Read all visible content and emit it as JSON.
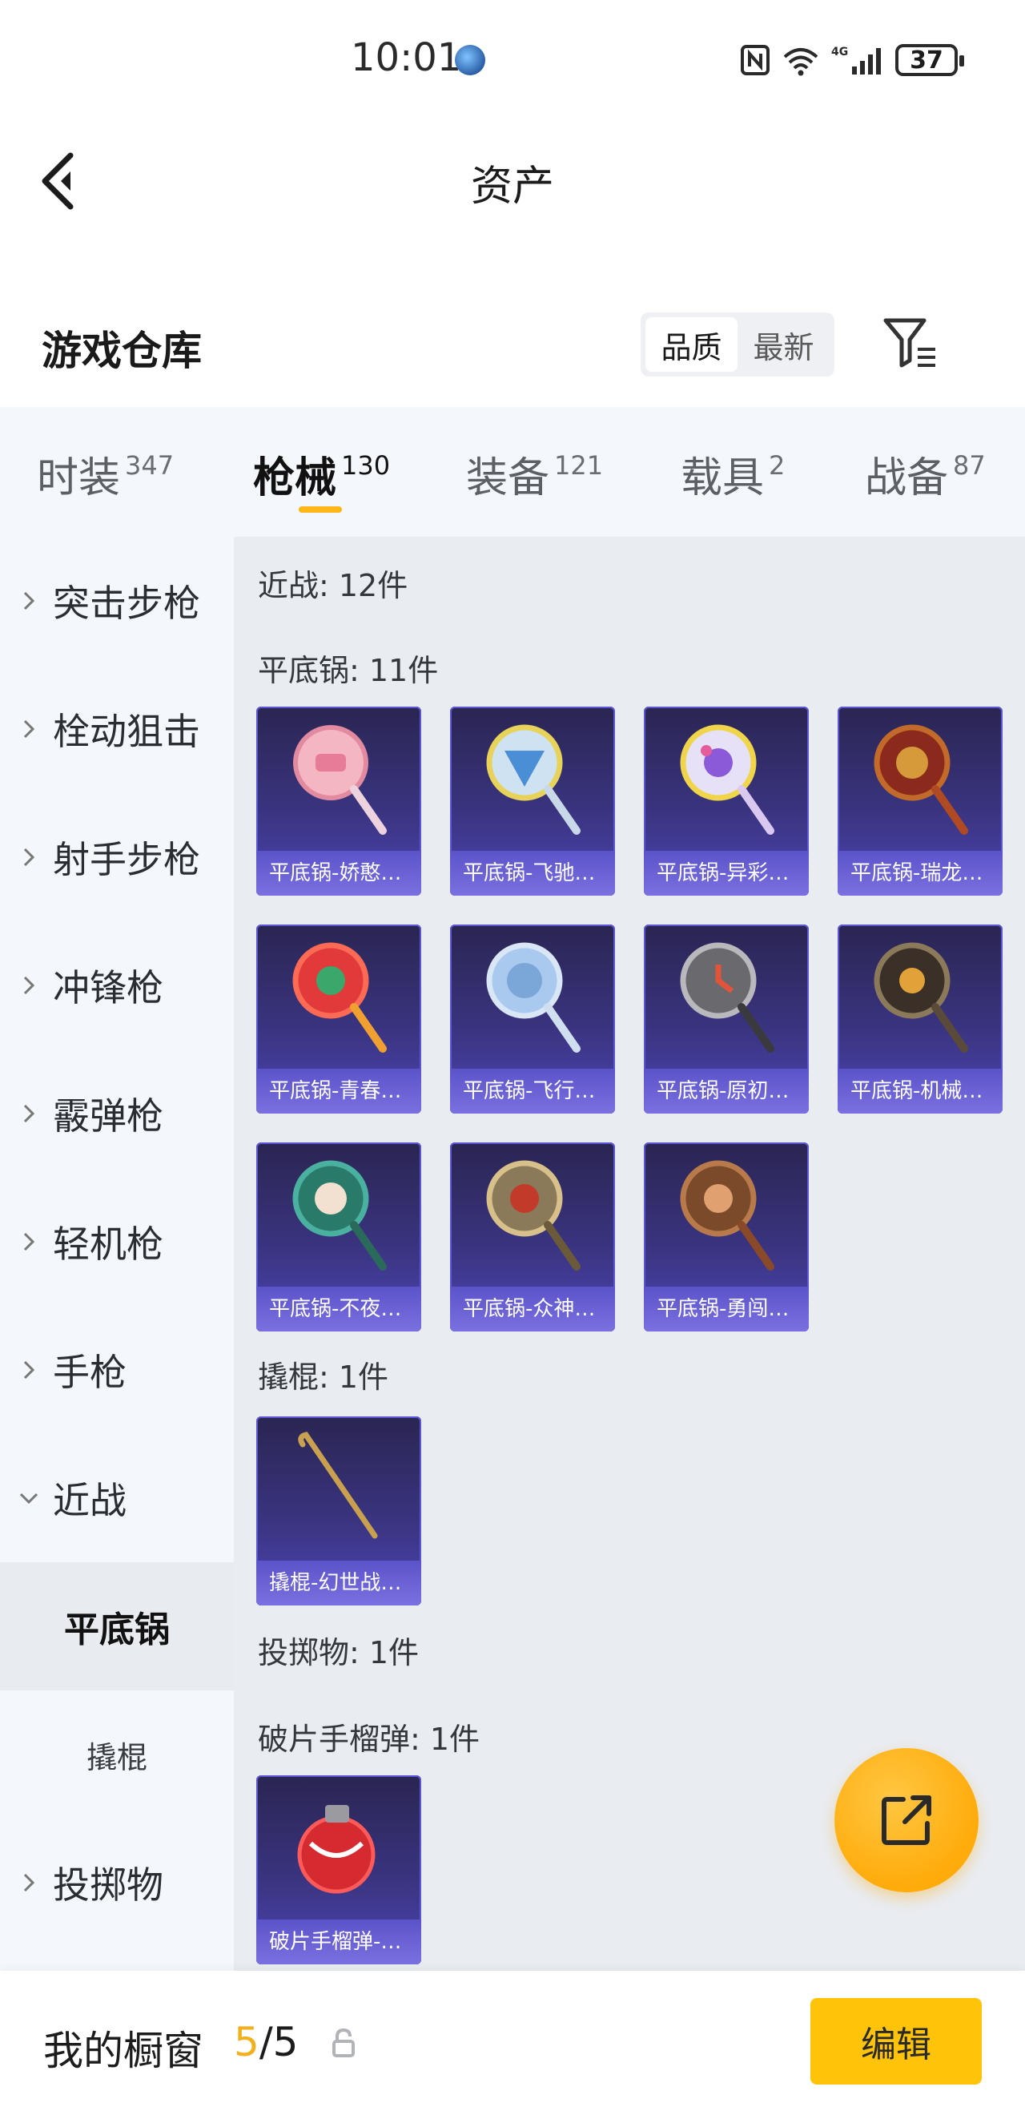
{
  "status_bar": {
    "time": "10:01",
    "signal_label": "4G",
    "wifi_label": "6",
    "battery": "37"
  },
  "header": {
    "title": "资产"
  },
  "section": {
    "title": "游戏仓库",
    "sort_options": [
      "品质",
      "最新"
    ]
  },
  "tabs": [
    {
      "label": "时装",
      "count": "347"
    },
    {
      "label": "枪械",
      "count": "130"
    },
    {
      "label": "装备",
      "count": "121"
    },
    {
      "label": "载具",
      "count": "2"
    },
    {
      "label": "战备",
      "count": "87"
    }
  ],
  "sidebar": {
    "items": [
      "突击步枪",
      "栓动狙击",
      "射手步枪",
      "冲锋枪",
      "霰弹枪",
      "轻机枪",
      "手枪",
      "近战"
    ],
    "sub_items": [
      "平底锅",
      "撬棍"
    ],
    "after": [
      "投掷物"
    ]
  },
  "content": {
    "melee_label": "近战: 12件",
    "pan_label": "平底锅: 11件",
    "pans": [
      "平底锅-娇憨…",
      "平底锅-飞驰…",
      "平底锅-异彩…",
      "平底锅-瑞龙…",
      "平底锅-青春…",
      "平底锅-飞行…",
      "平底锅-原初…",
      "平底锅-机械…",
      "平底锅-不夜…",
      "平底锅-众神…",
      "平底锅-勇闯…"
    ],
    "crowbar_label": "撬棍: 1件",
    "crowbars": [
      "撬棍-幻世战…"
    ],
    "throwable_label": "投掷物: 1件",
    "grenade_label": "破片手榴弹: 1件",
    "grenades": [
      "破片手榴弹-…"
    ]
  },
  "bottom_bar": {
    "title": "我的橱窗",
    "count_current": "5",
    "count_total": "/5",
    "edit_label": "编辑"
  },
  "colors": {
    "accent": "#ffb619",
    "card_bg": "#3a3480",
    "card_caption": "#6c63d8"
  }
}
